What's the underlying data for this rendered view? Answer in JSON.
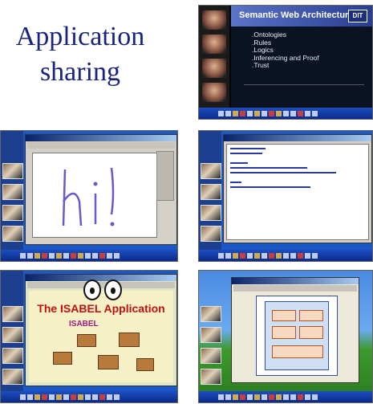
{
  "title": {
    "line1": "Application",
    "line2": "sharing"
  },
  "screenshots": [
    {
      "name": "slide-share",
      "slide_title": "Semantic Web Architecture",
      "logo_text": "DIT",
      "bullets": [
        ".Ontologies",
        ".Rules",
        ".Logics",
        ".Inferencing and Proof",
        ".Trust"
      ]
    },
    {
      "name": "whiteboard-share",
      "canvas_text": "hi!"
    },
    {
      "name": "notepad-share"
    },
    {
      "name": "isabel-share",
      "heading": "The ISABEL Application",
      "subheading": "ISABEL"
    },
    {
      "name": "diagram-share"
    }
  ]
}
